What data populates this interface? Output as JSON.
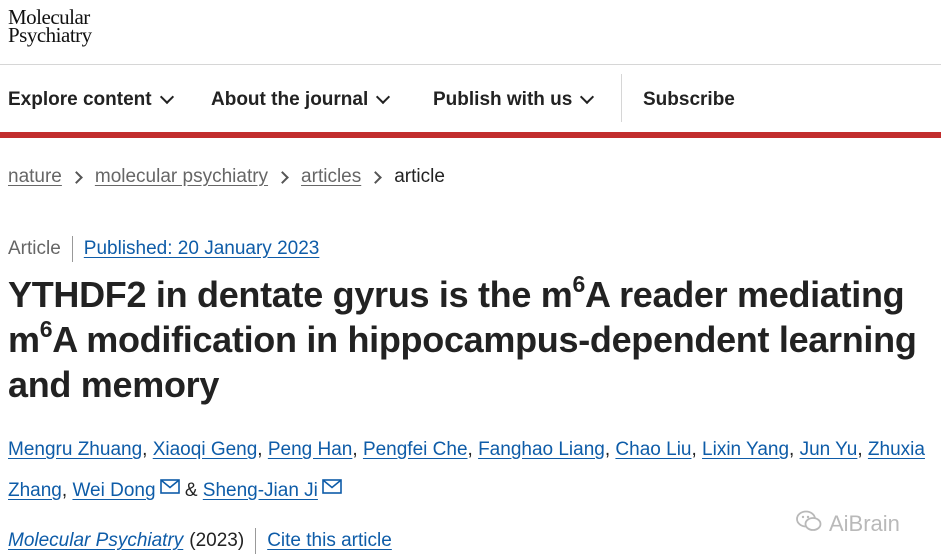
{
  "header": {
    "logo_line1": "Molecular",
    "logo_line2": "Psychiatry"
  },
  "nav": {
    "explore": "Explore content",
    "about": "About the journal",
    "publish": "Publish with us",
    "subscribe": "Subscribe"
  },
  "breadcrumb": {
    "items": [
      "nature",
      "molecular psychiatry",
      "articles"
    ],
    "current": "article"
  },
  "article": {
    "type": "Article",
    "published": "Published: 20 January 2023",
    "title_part1": "YTHDF2 in dentate gyrus is the m",
    "title_sup1": "6",
    "title_part2": "A reader mediating",
    "title_part3": "m",
    "title_sup2": "6",
    "title_part4": "A modification in hippocampus-dependent learning",
    "title_part5": "and memory",
    "authors": [
      "Mengru Zhuang",
      "Xiaoqi Geng",
      "Peng Han",
      "Pengfei Che",
      "Fanghao Liang",
      "Chao Liu",
      "Lixin Yang",
      "Jun Yu",
      "Zhuxia Zhang",
      "Wei Dong",
      "Sheng-Jian Ji"
    ],
    "amp": "&",
    "journal": "Molecular Psychiatry",
    "year": "(2023)",
    "cite": "Cite this article"
  },
  "watermark": {
    "text": "AiBrain"
  },
  "colors": {
    "accent_red": "#c22d2d",
    "link_blue": "#0e5ca8"
  }
}
